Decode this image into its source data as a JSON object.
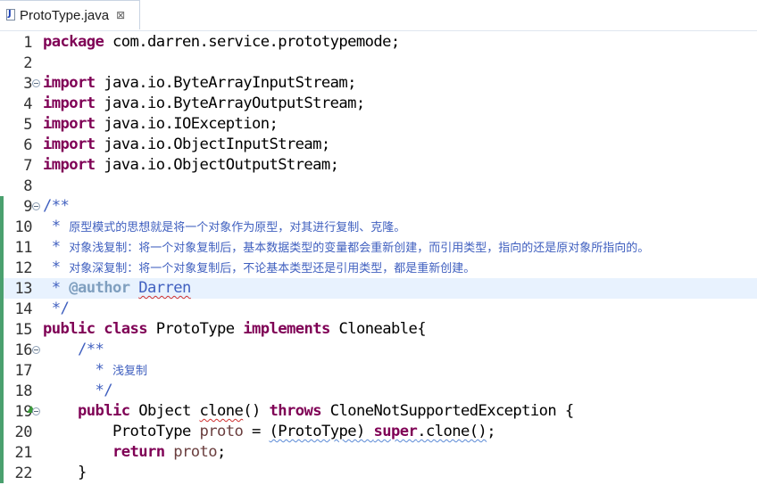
{
  "tab": {
    "icon": "java-file-icon",
    "title": "ProtoType.java",
    "close": "⊠"
  },
  "lines": [
    {
      "n": "1",
      "segs": [
        [
          "kw",
          "package"
        ],
        [
          "",
          "com.darren.service.prototypemode;"
        ]
      ]
    },
    {
      "n": "2",
      "segs": []
    },
    {
      "n": "3",
      "fold": true,
      "segs": [
        [
          "kw",
          "import"
        ],
        [
          "",
          "java.io.ByteArrayInputStream;"
        ]
      ]
    },
    {
      "n": "4",
      "segs": [
        [
          "kw",
          "import"
        ],
        [
          "",
          "java.io.ByteArrayOutputStream;"
        ]
      ]
    },
    {
      "n": "5",
      "segs": [
        [
          "kw",
          "import"
        ],
        [
          "",
          "java.io.IOException;"
        ]
      ]
    },
    {
      "n": "6",
      "segs": [
        [
          "kw",
          "import"
        ],
        [
          "",
          "java.io.ObjectInputStream;"
        ]
      ]
    },
    {
      "n": "7",
      "segs": [
        [
          "kw",
          "import"
        ],
        [
          "",
          "java.io.ObjectOutputStream;"
        ]
      ]
    },
    {
      "n": "8",
      "segs": []
    },
    {
      "n": "9",
      "fold": true,
      "mark": true,
      "segs": [
        [
          "cmt",
          "/**"
        ]
      ]
    },
    {
      "n": "10",
      "mark": true,
      "segs": [
        [
          "cmt",
          " * "
        ],
        [
          "cmtcjk",
          "原型模式的思想就是将一个对象作为原型，对其进行复制、克隆。"
        ]
      ]
    },
    {
      "n": "11",
      "mark": true,
      "segs": [
        [
          "cmt",
          " * "
        ],
        [
          "cmtcjk",
          "对象浅复制：将一个对象复制后，基本数据类型的变量都会重新创建，而引用类型，指向的还是原对象所指向的。"
        ]
      ]
    },
    {
      "n": "12",
      "mark": true,
      "segs": [
        [
          "cmt",
          " * "
        ],
        [
          "cmtcjk",
          "对象深复制：将一个对象复制后，不论基本类型还是引用类型，都是重新创建。"
        ]
      ]
    },
    {
      "n": "13",
      "mark": true,
      "current": true,
      "segs": [
        [
          "cmt",
          " * "
        ],
        [
          "tag",
          "@author"
        ],
        [
          "cmt",
          " "
        ],
        [
          "cmtsquig",
          "Darren"
        ]
      ]
    },
    {
      "n": "14",
      "mark": true,
      "segs": [
        [
          "cmt",
          " */"
        ]
      ]
    },
    {
      "n": "15",
      "mark": true,
      "segs": [
        [
          "kw",
          "public"
        ],
        [
          "",
          " "
        ],
        [
          "kw",
          "class"
        ],
        [
          "",
          " ProtoType "
        ],
        [
          "kw",
          "implements"
        ],
        [
          "",
          " Cloneable{"
        ]
      ]
    },
    {
      "n": "16",
      "fold": true,
      "mark": true,
      "segs": [
        [
          "",
          "    "
        ],
        [
          "cmt",
          "/**"
        ]
      ]
    },
    {
      "n": "17",
      "mark": true,
      "segs": [
        [
          "",
          "    "
        ],
        [
          "cmt",
          "  * "
        ],
        [
          "cmtcjk",
          "浅复制"
        ]
      ]
    },
    {
      "n": "18",
      "mark": true,
      "segs": [
        [
          "",
          "    "
        ],
        [
          "cmt",
          "  */"
        ]
      ]
    },
    {
      "n": "19",
      "fold": true,
      "override": true,
      "mark": true,
      "segs": [
        [
          "",
          "    "
        ],
        [
          "kw",
          "public"
        ],
        [
          "",
          " Object "
        ],
        [
          "squig",
          "clone"
        ],
        [
          "",
          "() "
        ],
        [
          "kw",
          "throws"
        ],
        [
          "",
          " CloneNotSupportedException {"
        ]
      ]
    },
    {
      "n": "20",
      "mark": true,
      "segs": [
        [
          "",
          "        ProtoType "
        ],
        [
          "var",
          "proto"
        ],
        [
          "",
          " = "
        ],
        [
          "squigblue",
          "(ProtoType) "
        ],
        [
          "kwsquig",
          "super"
        ],
        [
          "squigblue",
          ".clone()"
        ],
        [
          ";"
        ]
      ]
    },
    {
      "n": "21",
      "mark": true,
      "segs": [
        [
          "",
          "        "
        ],
        [
          "kw",
          "return"
        ],
        [
          "",
          " "
        ],
        [
          "var",
          "proto"
        ],
        [
          "",
          ";"
        ]
      ]
    },
    {
      "n": "22",
      "mark": true,
      "segs": [
        [
          "",
          "    }"
        ]
      ]
    }
  ],
  "colors": {
    "keyword": "#7f0055",
    "comment": "#3f5fbf",
    "javadoc_tag": "#7f9fbf",
    "variable": "#6a3e3e",
    "current_line": "#e8f2fe",
    "change_marker": "#4aa06e"
  }
}
